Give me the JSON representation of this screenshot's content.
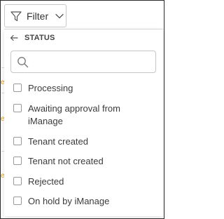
{
  "filter_button": {
    "label": "Filter"
  },
  "panel": {
    "header": "STATUS",
    "search": {
      "placeholder": ""
    },
    "options": [
      {
        "label": "Processing",
        "checked": false
      },
      {
        "label": "Awaiting approval from iManage",
        "checked": false
      },
      {
        "label": "Tenant created",
        "checked": false
      },
      {
        "label": "Tenant not created",
        "checked": false
      },
      {
        "label": "Rejected",
        "checked": false
      },
      {
        "label": "On hold by iManage",
        "checked": false
      }
    ]
  },
  "colors": {
    "text": "#3b3b3b",
    "border": "#c6c6c6",
    "accent_mark": "#e0a020"
  }
}
